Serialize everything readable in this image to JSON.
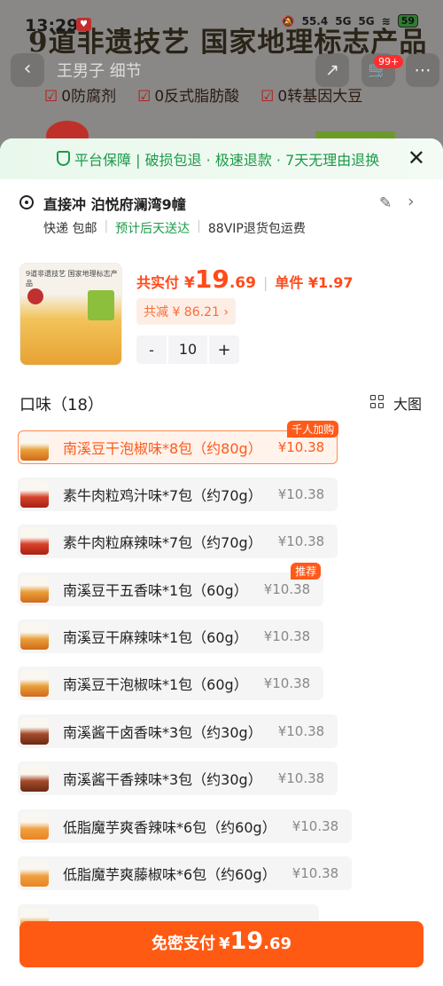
{
  "status_bar": {
    "time": "13:29",
    "net_speed": "55.4",
    "net_unit": "KB/s",
    "sig1": "5G",
    "sig2": "5G",
    "battery": "59"
  },
  "background": {
    "title": "9道非遗技艺 国家地理标志产品",
    "subtitle": "王男子 细节",
    "features": [
      "0防腐剂",
      "0反式脂肪酸",
      "0转基因大豆"
    ],
    "cart_badge": "99+"
  },
  "sheet": {
    "guarantee": "平台保障 | 破损包退 · 极速退款 · 7天无理由退换",
    "address": "直接冲 泊悦府澜湾9幢",
    "ship_method": "快递 包邮",
    "ship_eta": "预计后天送达",
    "ship_return": "88VIP退货包运费",
    "product": {
      "thumb_title": "9道非遗技艺 国家地理标志产品",
      "total_label": "共实付",
      "currency": "¥",
      "total_int": "19",
      "total_dec": ".69",
      "unit_price": "单件 ¥1.97",
      "discount": "共减 ¥ 86.21 ›",
      "quantity": "10",
      "minus": "-",
      "plus": "+"
    },
    "flavor_header": "口味（18）",
    "big_image_label": "大图",
    "options": [
      {
        "name": "南溪豆干泡椒味*8包（约80g）",
        "price": "¥10.38",
        "tag": "千人加购"
      },
      {
        "name": "素牛肉粒鸡汁味*7包（约70g）",
        "price": "¥10.38",
        "tag": ""
      },
      {
        "name": "素牛肉粒麻辣味*7包（约70g）",
        "price": "¥10.38",
        "tag": ""
      },
      {
        "name": "南溪豆干五香味*1包（60g）",
        "price": "¥10.38",
        "tag": "推荐"
      },
      {
        "name": "南溪豆干麻辣味*1包（60g）",
        "price": "¥10.38",
        "tag": ""
      },
      {
        "name": "南溪豆干泡椒味*1包（60g）",
        "price": "¥10.38",
        "tag": ""
      },
      {
        "name": "南溪酱干卤香味*3包（约30g）",
        "price": "¥10.38",
        "tag": ""
      },
      {
        "name": "南溪酱干香辣味*3包（约30g）",
        "price": "¥10.38",
        "tag": ""
      },
      {
        "name": "低脂魔芋爽香辣味*6包（约60g）",
        "price": "¥10.38",
        "tag": ""
      },
      {
        "name": "低脂魔芋爽藤椒味*6包（约60g）",
        "price": "¥10.38",
        "tag": ""
      }
    ],
    "pay_button": {
      "label": "免密支付",
      "currency": "¥",
      "int": "19",
      "dec": ".69"
    }
  },
  "colors": {
    "accent": "#ff5a14",
    "guarantee_green": "#1d9a4a",
    "selected_border": "#ff8a50"
  }
}
